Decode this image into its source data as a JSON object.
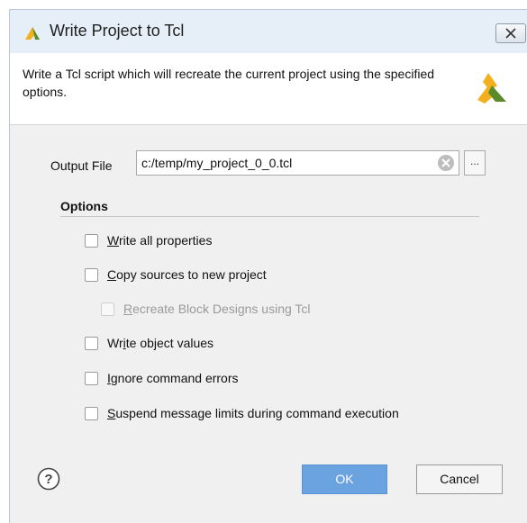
{
  "window": {
    "title": "Write Project to Tcl"
  },
  "header": {
    "description": "Write a Tcl script which will recreate the current project using the specified options."
  },
  "output_file": {
    "label": "Output File",
    "value": "c:/temp/my_project_0_0.tcl",
    "browse_label": "..."
  },
  "options": {
    "title": "Options",
    "items": [
      {
        "mnemonic": "W",
        "rest": "rite all properties",
        "checked": false,
        "enabled": true
      },
      {
        "mnemonic": "C",
        "rest": "opy sources to new project",
        "checked": false,
        "enabled": true
      },
      {
        "mnemonic": "R",
        "rest": "ecreate Block Designs using Tcl",
        "checked": false,
        "enabled": false
      },
      {
        "prefix": "Wr",
        "mnemonic": "i",
        "rest": "te object values",
        "checked": false,
        "enabled": true
      },
      {
        "mnemonic": "I",
        "rest": "gnore command errors",
        "checked": false,
        "enabled": true
      },
      {
        "mnemonic": "S",
        "rest": "uspend message limits during command execution",
        "checked": false,
        "enabled": true
      }
    ]
  },
  "footer": {
    "ok_label": "OK",
    "cancel_label": "Cancel",
    "help_label": "?"
  },
  "colors": {
    "ok_button": "#6aa3e0",
    "title_bar": "#e6eef7",
    "logo_yellow": "#f2b01e",
    "logo_green": "#5a8a2a"
  },
  "icons": {
    "title_logo": "vivado-logo-icon",
    "header_logo": "vivado-logo-icon",
    "close": "close-icon",
    "clear": "clear-input-icon",
    "help": "help-icon"
  }
}
